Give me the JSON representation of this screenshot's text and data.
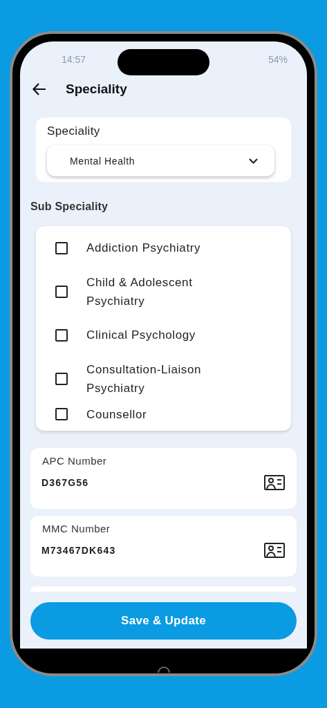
{
  "status_bar": {
    "time": "14:57",
    "battery": "54%"
  },
  "header": {
    "title": "Speciality"
  },
  "speciality": {
    "label": "Speciality",
    "value": "Mental Health"
  },
  "sub_speciality": {
    "title": "Sub Speciality",
    "options": [
      {
        "label": "Addiction Psychiatry",
        "checked": false
      },
      {
        "label": "Child & Adolescent Psychiatry",
        "checked": false
      },
      {
        "label": "Clinical Psychology",
        "checked": false
      },
      {
        "label": "Consultation-Liaison Psychiatry",
        "checked": false
      },
      {
        "label": "Counsellor",
        "checked": false
      }
    ]
  },
  "fields": [
    {
      "label": "APC Number",
      "value": "D367G56"
    },
    {
      "label": "MMC Number",
      "value": "M73467DK643"
    }
  ],
  "button": "Save & Update"
}
